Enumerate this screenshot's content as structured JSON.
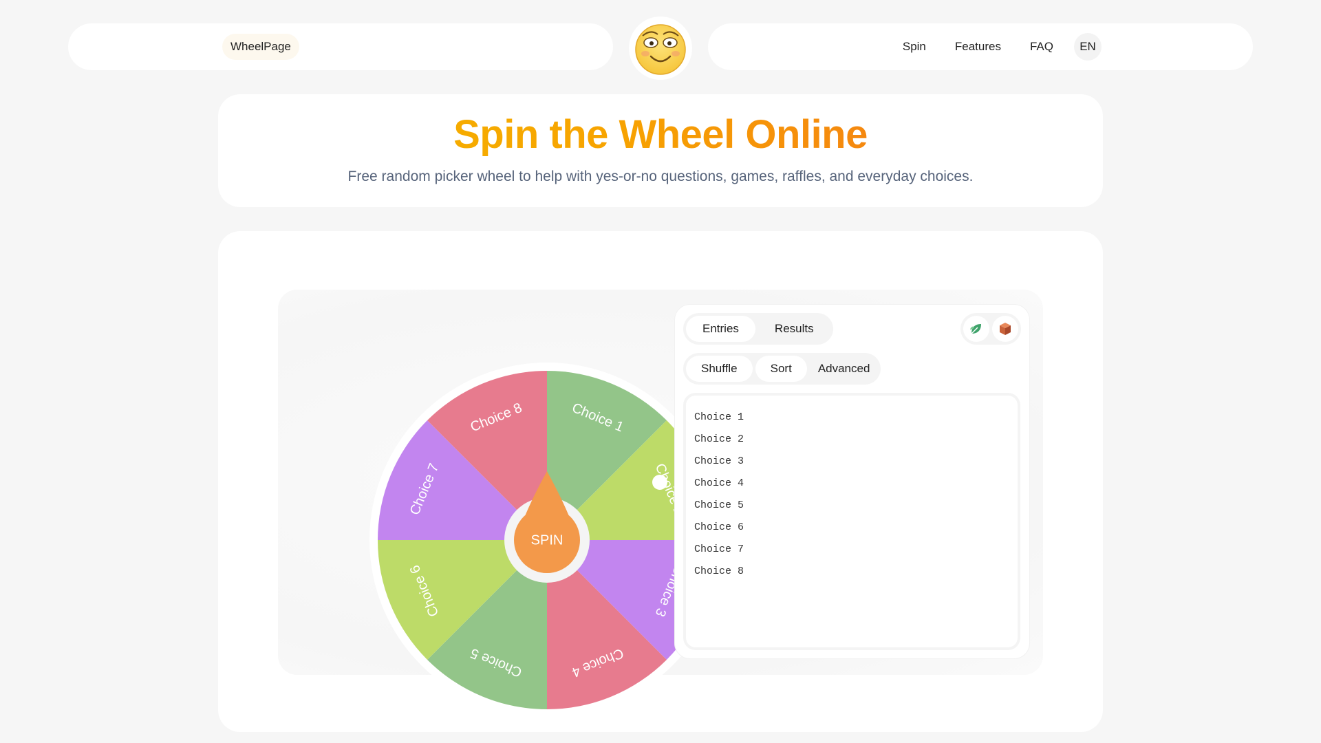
{
  "header": {
    "brand": "WheelPage",
    "nav": [
      {
        "label": "Spin"
      },
      {
        "label": "Features"
      },
      {
        "label": "FAQ"
      }
    ],
    "lang": "EN"
  },
  "hero": {
    "title": "Spin the Wheel Online",
    "subtitle": "Free random picker wheel to help with yes-or-no questions, games, raffles, and everyday choices."
  },
  "wheel": {
    "spin_label": "SPIN",
    "segments": [
      "Choice 1",
      "Choice 2",
      "Choice 3",
      "Choice 4",
      "Choice 5",
      "Choice 6",
      "Choice 7",
      "Choice 8"
    ],
    "colors": [
      "#93c589",
      "#bddb68",
      "#c285ef",
      "#e77b8e",
      "#93c589",
      "#bddb68",
      "#c285ef",
      "#e77b8e"
    ],
    "hub_color": "#f3994a"
  },
  "panel": {
    "tabs": [
      {
        "label": "Entries",
        "active": true
      },
      {
        "label": "Results",
        "active": false
      }
    ],
    "tools": {
      "shuffle": "Shuffle",
      "sort": "Sort",
      "advanced": "Advanced"
    },
    "icons": [
      "leaf-icon",
      "box-icon"
    ],
    "entries": [
      "Choice 1",
      "Choice 2",
      "Choice 3",
      "Choice 4",
      "Choice 5",
      "Choice 6",
      "Choice 7",
      "Choice 8"
    ]
  }
}
